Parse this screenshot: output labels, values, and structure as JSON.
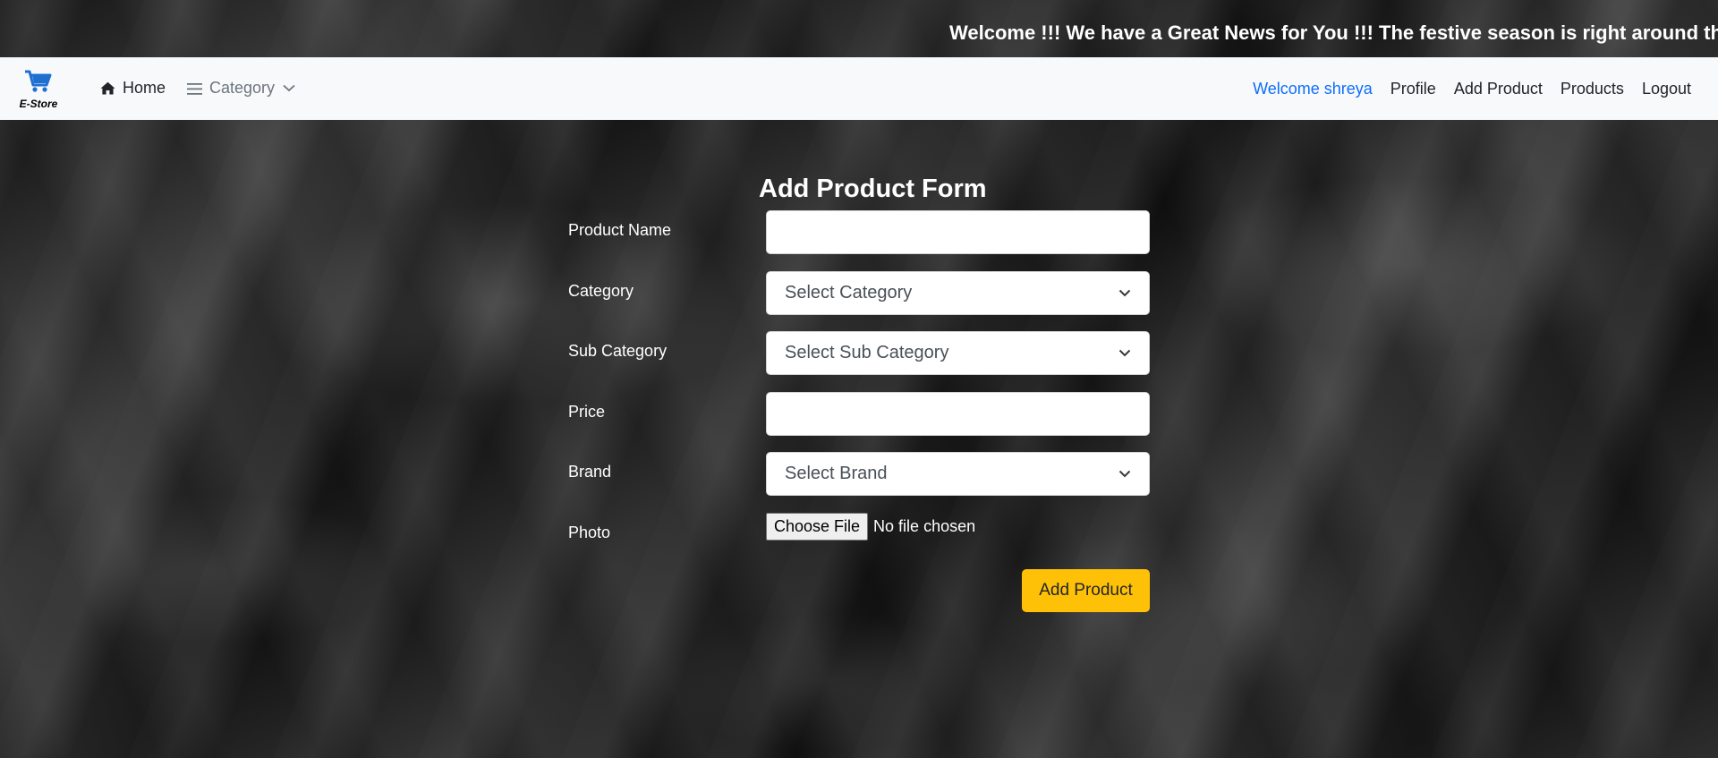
{
  "marquee": {
    "text": "Welcome !!! We have a Great News for You !!! The festive season is right around the c"
  },
  "navbar": {
    "brand": "E-Store",
    "brand_icon": "cart-icon",
    "home_label": "Home",
    "home_icon": "home-icon",
    "category_label": "Category",
    "category_icon": "bars-icon",
    "welcome_text": "Welcome shreya",
    "links": [
      "Profile",
      "Add Product",
      "Products",
      "Logout"
    ],
    "colors": {
      "background": "#f8f9fa",
      "welcome": "#0d6efd"
    }
  },
  "form": {
    "title": "Add Product Form",
    "fields": {
      "product_name": {
        "label": "Product Name",
        "value": ""
      },
      "category": {
        "label": "Category",
        "selected": "Select Category"
      },
      "sub_category": {
        "label": "Sub Category",
        "selected": "Select Sub Category"
      },
      "price": {
        "label": "Price",
        "value": ""
      },
      "brand": {
        "label": "Brand",
        "selected": "Select Brand"
      },
      "photo": {
        "label": "Photo",
        "button": "Choose File",
        "status": "No file chosen"
      }
    },
    "submit_label": "Add Product",
    "colors": {
      "submit": "#ffc107"
    }
  }
}
